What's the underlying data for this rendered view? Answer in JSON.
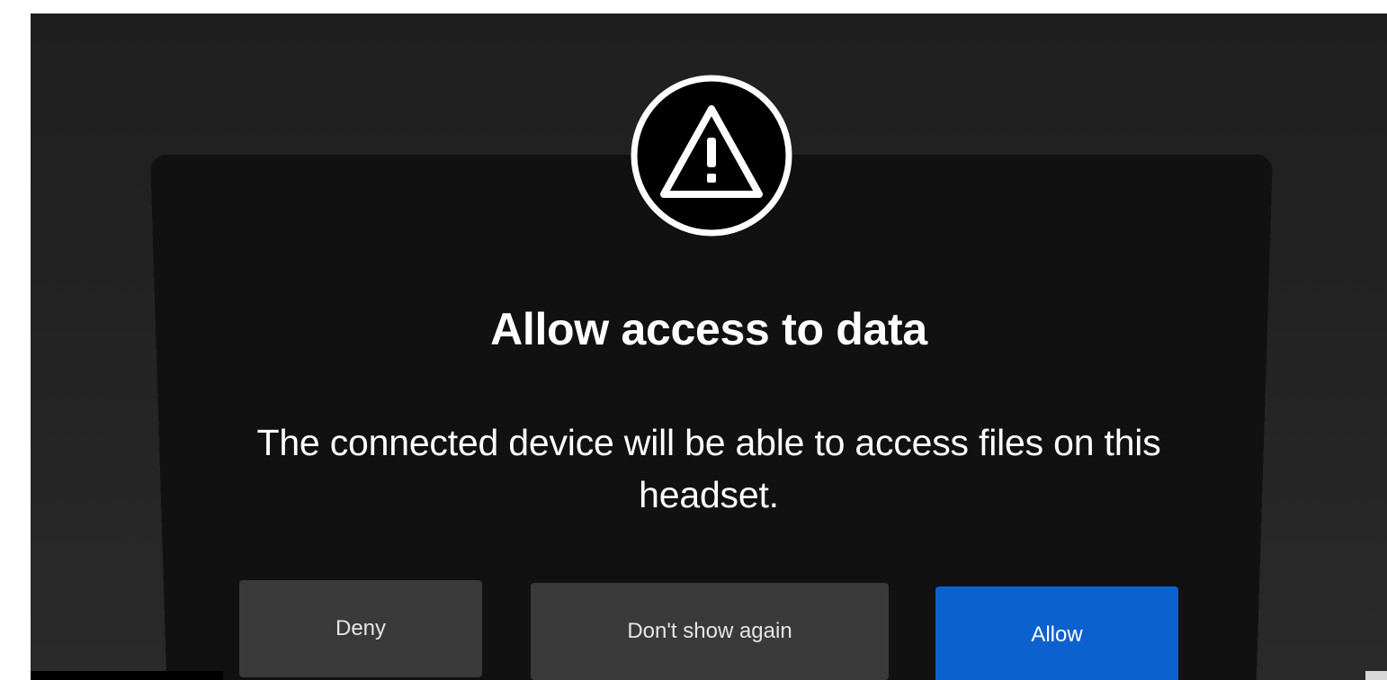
{
  "dialog": {
    "icon": "warning-triangle-icon",
    "title": "Allow access to data",
    "message": "The connected device will be able to access files on this headset.",
    "buttons": {
      "deny": "Deny",
      "dont_show": "Don't show again",
      "allow": "Allow"
    }
  },
  "colors": {
    "background": "#232323",
    "panel": "#111111",
    "button_secondary": "#3a3a3a",
    "button_primary": "#0b62cf",
    "text": "#ffffff"
  }
}
